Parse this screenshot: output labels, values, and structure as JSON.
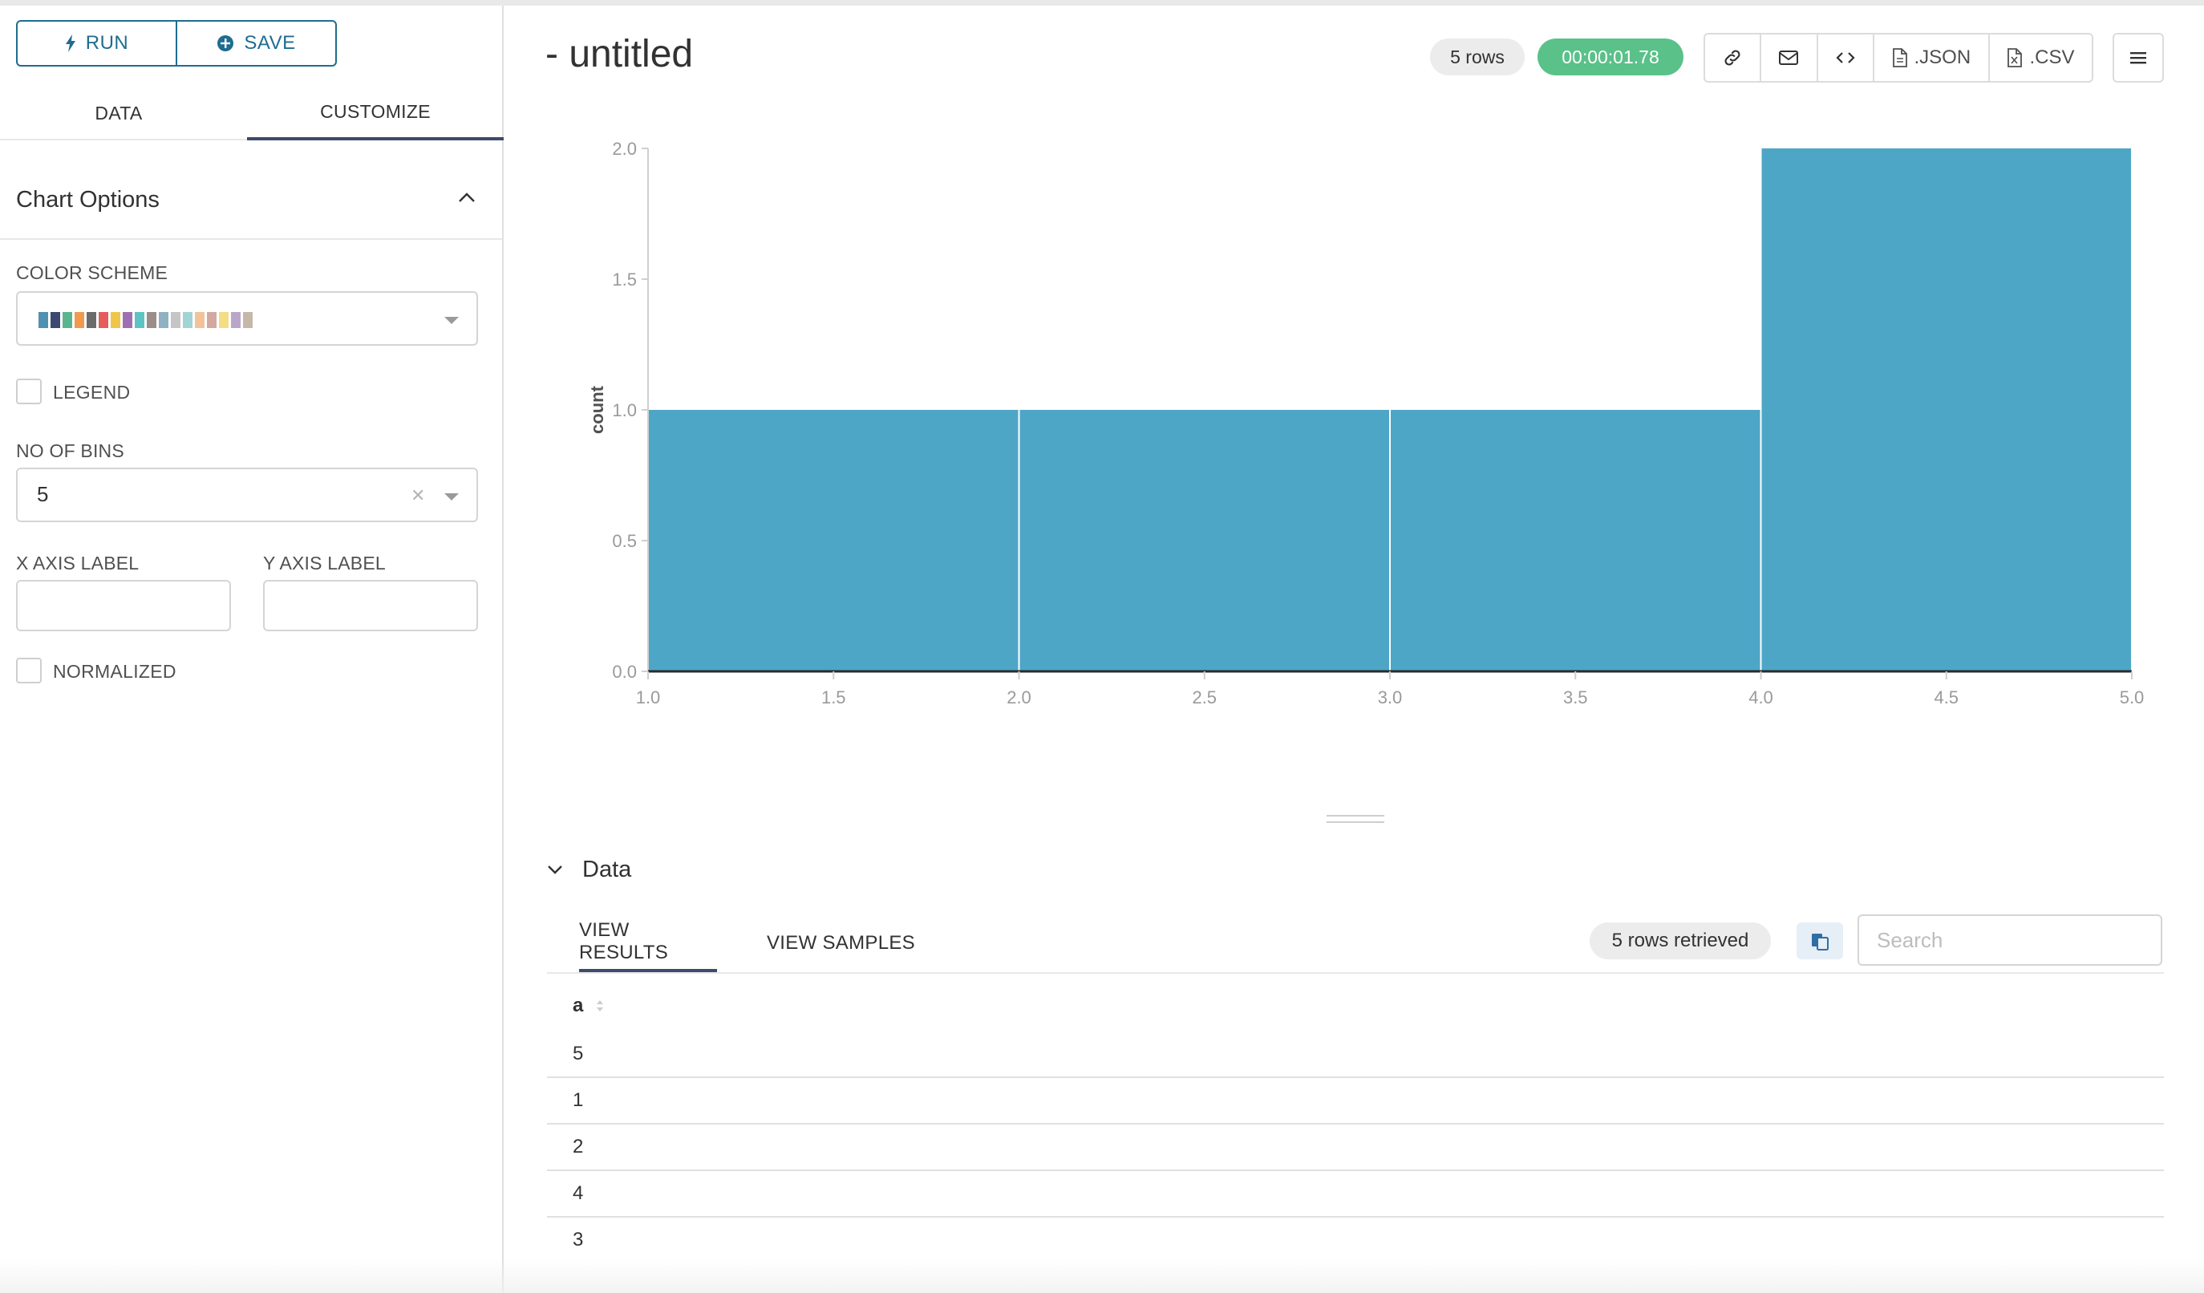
{
  "toolbar": {
    "run_label": "RUN",
    "save_label": "SAVE"
  },
  "left_tabs": {
    "data": "DATA",
    "customize": "CUSTOMIZE"
  },
  "chart_options": {
    "title": "Chart Options",
    "color_scheme_label": "COLOR SCHEME",
    "color_scheme_swatches": [
      "#4e91b3",
      "#3b4870",
      "#5ab48d",
      "#f19a4e",
      "#6b6b6b",
      "#e45c5c",
      "#f0c64a",
      "#9f6fb4",
      "#5dc4c5",
      "#9c8d8a",
      "#8fb1c4",
      "#c5c5c5",
      "#a1d4d4",
      "#f2c29a",
      "#d3a8a0",
      "#f5dd85",
      "#b9a7c9",
      "#c5b8a8"
    ],
    "legend_label": "LEGEND",
    "bins_label": "NO OF BINS",
    "bins_value": "5",
    "x_axis_label": "X AXIS LABEL",
    "y_axis_label": "Y AXIS LABEL",
    "normalized_label": "NORMALIZED"
  },
  "header": {
    "title": "- untitled",
    "rows_pill": "5 rows",
    "timer": "00:00:01.78",
    "json_label": ".JSON",
    "csv_label": ".CSV"
  },
  "chart_data": {
    "type": "bar",
    "ylabel": "count",
    "xlabel": "",
    "bins": [
      [
        1.0,
        2.0
      ],
      [
        2.0,
        3.0
      ],
      [
        3.0,
        4.0
      ],
      [
        4.0,
        5.0
      ]
    ],
    "values": [
      1,
      1,
      1,
      2
    ],
    "xlim": [
      1.0,
      5.0
    ],
    "ylim": [
      0.0,
      2.0
    ],
    "x_ticks": [
      "1.0",
      "1.5",
      "2.0",
      "2.5",
      "3.0",
      "3.5",
      "4.0",
      "4.5",
      "5.0"
    ],
    "y_ticks": [
      "0.0",
      "0.5",
      "1.0",
      "1.5",
      "2.0"
    ],
    "color": "#4ea6c6",
    "grid": false
  },
  "data_section": {
    "title": "Data",
    "tab_results": "VIEW RESULTS",
    "tab_samples": "VIEW SAMPLES",
    "retrieved": "5 rows retrieved",
    "search_placeholder": "Search",
    "columns": [
      "a"
    ],
    "rows": [
      "5",
      "1",
      "2",
      "4",
      "3"
    ]
  }
}
